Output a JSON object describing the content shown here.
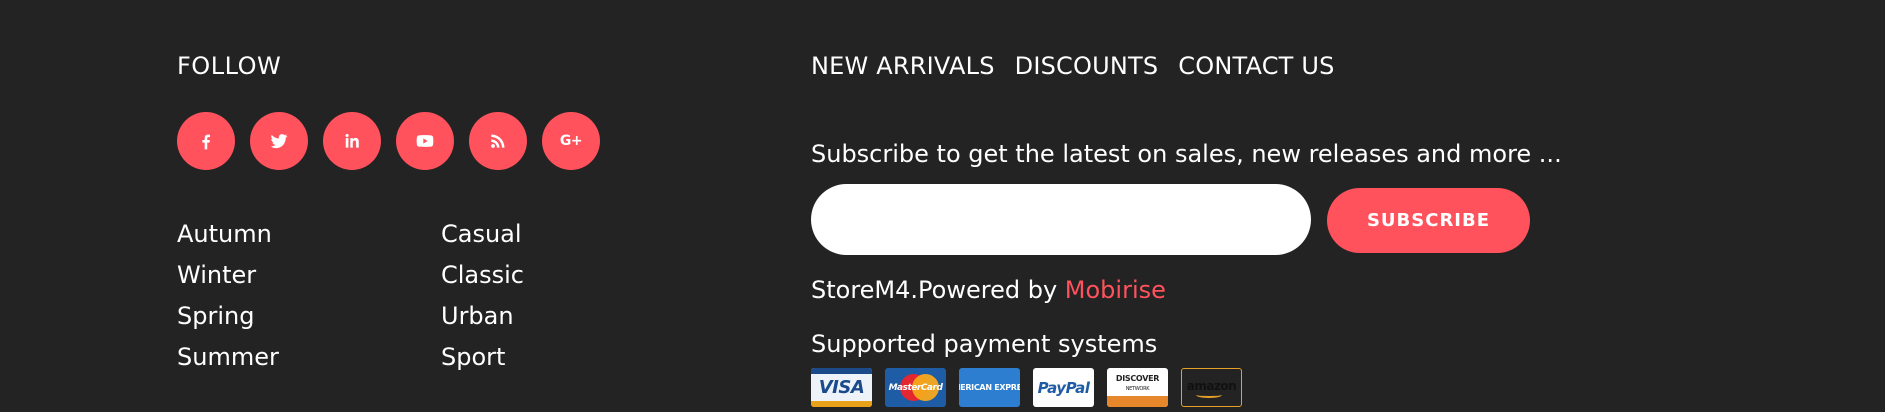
{
  "follow": {
    "title": "FOLLOW",
    "social": [
      {
        "name": "facebook-icon"
      },
      {
        "name": "twitter-icon"
      },
      {
        "name": "linkedin-icon"
      },
      {
        "name": "youtube-icon"
      },
      {
        "name": "rss-icon"
      },
      {
        "name": "google-plus-icon",
        "glyph": "G+"
      }
    ],
    "accent": "#ff525d"
  },
  "categories": {
    "col1": [
      "Autumn",
      "Winter",
      "Spring",
      "Summer"
    ],
    "col2": [
      "Casual",
      "Classic",
      "Urban",
      "Sport"
    ]
  },
  "nav": {
    "items": [
      "NEW ARRIVALS",
      "DISCOUNTS",
      "CONTACT US"
    ]
  },
  "subscribe": {
    "text": "Subscribe to get the latest on sales, new releases and more ...",
    "input_value": "",
    "button_label": "SUBSCRIBE"
  },
  "powered": {
    "prefix": "StoreM4.Powered by ",
    "link": "Mobirise"
  },
  "payments": {
    "title": "Supported payment systems",
    "cards": [
      {
        "name": "visa",
        "label": "VISA"
      },
      {
        "name": "mastercard",
        "label": "MasterCard"
      },
      {
        "name": "american-express",
        "label": "AMERICAN EXPRESS"
      },
      {
        "name": "paypal",
        "label": "PayPal"
      },
      {
        "name": "discover",
        "label": "DISCOVER",
        "sub": "NETWORK"
      },
      {
        "name": "amazon",
        "label": "amazon"
      }
    ]
  },
  "colors": {
    "background": "#232323",
    "accent": "#ff525d",
    "text": "#ffffff"
  }
}
